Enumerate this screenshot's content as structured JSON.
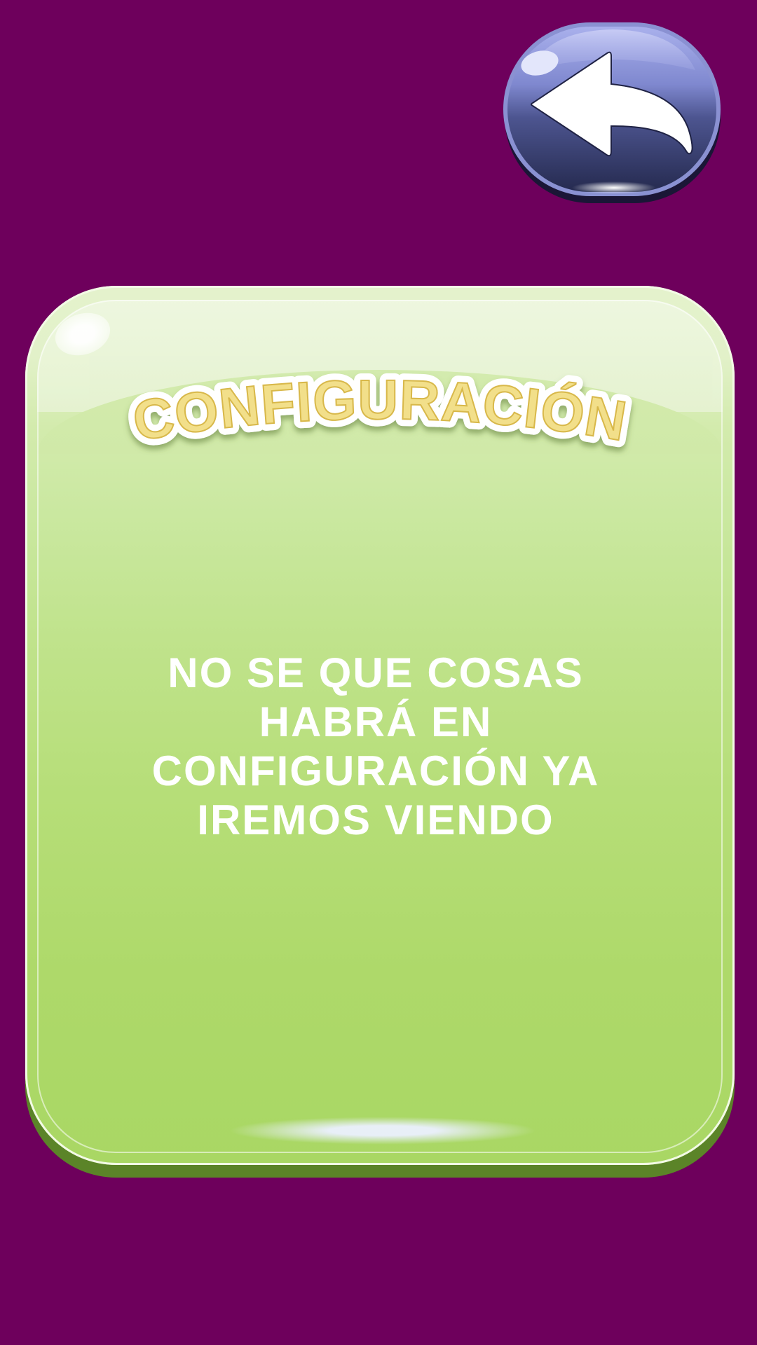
{
  "screen": {
    "background_color": "#6e005c"
  },
  "back_button": {
    "icon": "back-arrow-icon",
    "color": "#4a5294"
  },
  "panel": {
    "title": "CONFIGURACIÓN",
    "message": "NO SE QUE COSAS HABRÁ EN CONFIGURACIÓN YA IREMOS VIENDO",
    "background_color": "#b6de78",
    "title_color": "#f2df8a"
  }
}
